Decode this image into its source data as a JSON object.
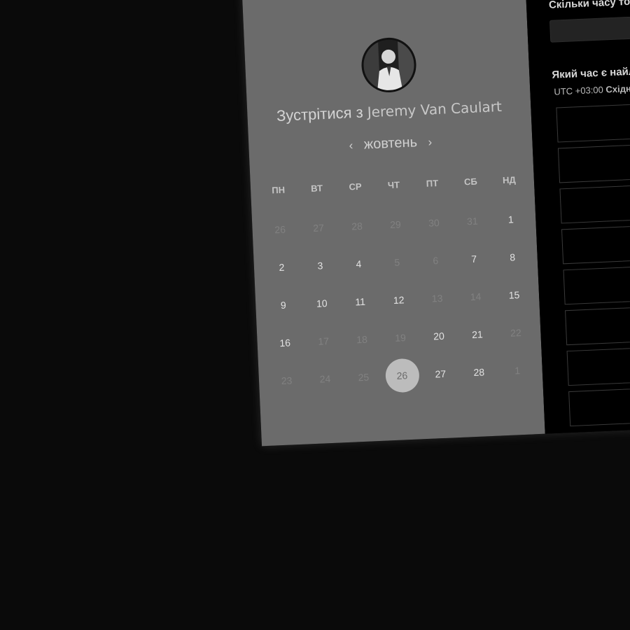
{
  "header": {
    "title_prefix": "Зустрітися з",
    "host_name": "Jeremy Van Caulart"
  },
  "calendar": {
    "month": "жовтень",
    "prev_icon": "‹",
    "next_icon": "›",
    "weekdays": [
      "ПН",
      "ВТ",
      "СР",
      "ЧТ",
      "ПТ",
      "СБ",
      "НД"
    ],
    "weeks": [
      [
        "26",
        "27",
        "28",
        "29",
        "30",
        "31",
        "1"
      ],
      [
        "2",
        "3",
        "4",
        "5",
        "6",
        "7",
        "8"
      ],
      [
        "9",
        "10",
        "11",
        "12",
        "13",
        "14",
        "15"
      ],
      [
        "16",
        "17",
        "18",
        "19",
        "20",
        "21",
        "22"
      ],
      [
        "23",
        "24",
        "25",
        "26",
        "27",
        "28",
        "1"
      ]
    ],
    "selected_day": "26"
  },
  "booking": {
    "duration_label": "Скільки часу то",
    "time_label": "Який час є найл",
    "timezone_offset": "UTC +03:00",
    "timezone_name": "Східн"
  },
  "colors": {
    "background": "#0a0a0a",
    "calendar_panel": "#6b6b6b",
    "selected_day_bg": "#bcbcbc"
  }
}
